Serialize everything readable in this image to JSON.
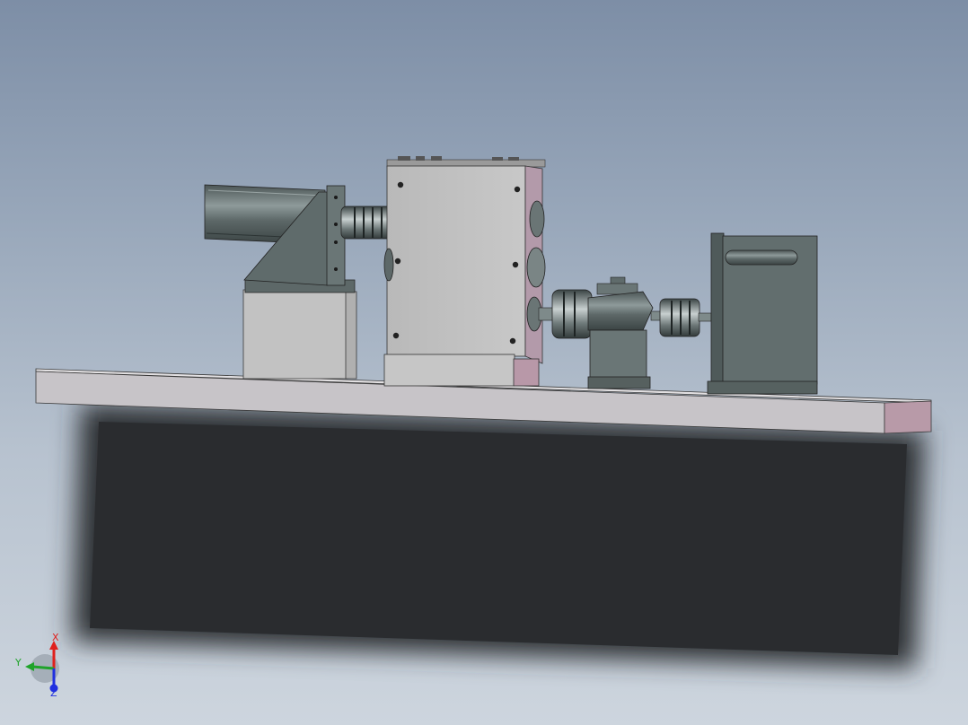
{
  "viewport": {
    "background_top": "#7d8ea6",
    "background_bottom": "#cdd5de"
  },
  "model": {
    "base_plate_color": "#c7c4c8",
    "base_plate_end_color": "#b89aa8",
    "machined_part_color": "#5f6b6b",
    "housing_color": "#c0c0c0",
    "shadow_color": "#2d3033"
  },
  "triad": {
    "x_label": "X",
    "y_label": "Y",
    "z_label": "Z",
    "x_color": "#e0201c",
    "y_color": "#1fa32a",
    "z_color": "#2030e0"
  }
}
